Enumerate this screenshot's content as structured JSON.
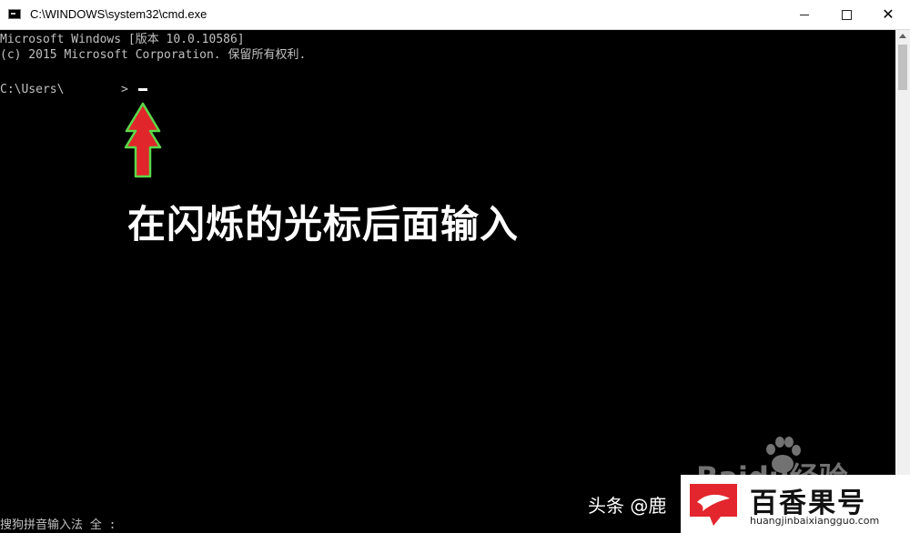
{
  "window": {
    "title": "C:\\WINDOWS\\system32\\cmd.exe",
    "minimize_icon": "minimize-icon",
    "maximize_icon": "maximize-icon",
    "close_icon": "close-icon"
  },
  "console": {
    "line1": "Microsoft Windows [版本 10.0.10586]",
    "line2": "(c) 2015 Microsoft Corporation. 保留所有权利.",
    "prompt": "C:\\Users\\        >"
  },
  "annotation": {
    "text": "在闪烁的光标后面输入",
    "arrow_color": "#e0262a",
    "arrow_outline": "#5bd84a"
  },
  "ime": {
    "status": "搜狗拼音输入法 全 :"
  },
  "watermarks": {
    "baidu": "Baidu经验",
    "toutiao": "头条 @鹿",
    "brand_name": "百香果号",
    "brand_url": "huangjinbaixiangguo.com"
  }
}
